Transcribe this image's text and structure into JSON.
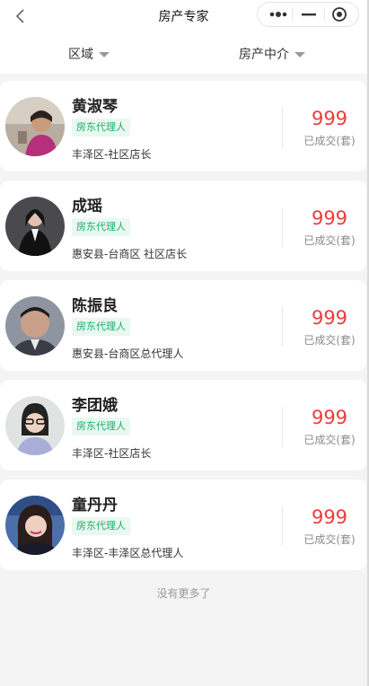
{
  "nav": {
    "title": "房产专家",
    "back_icon": "back-chevron-icon"
  },
  "capsule": {
    "more_icon": "more-dots-icon",
    "minimize_icon": "minus-icon",
    "close_icon": "target-circle-icon"
  },
  "filters": [
    {
      "label": "区域",
      "icon": "caret-down-icon"
    },
    {
      "label": "房产中介",
      "icon": "caret-down-icon"
    }
  ],
  "agents": [
    {
      "name": "黄淑琴",
      "tag": "房东代理人",
      "location": "丰泽区-社区店长",
      "deals": "999",
      "deals_label": "已成交(套)"
    },
    {
      "name": "成瑶",
      "tag": "房东代理人",
      "location": "惠安县-台商区 社区店长",
      "deals": "999",
      "deals_label": "已成交(套)"
    },
    {
      "name": "陈振良",
      "tag": "房东代理人",
      "location": "惠安县-台商区总代理人",
      "deals": "999",
      "deals_label": "已成交(套)"
    },
    {
      "name": "李团娥",
      "tag": "房东代理人",
      "location": "丰泽区-社区店长",
      "deals": "999",
      "deals_label": "已成交(套)"
    },
    {
      "name": "童丹丹",
      "tag": "房东代理人",
      "location": "丰泽区-丰泽区总代理人",
      "deals": "999",
      "deals_label": "已成交(套)"
    }
  ],
  "footer": {
    "no_more": "没有更多了"
  },
  "colors": {
    "accent_red": "#ee3b3b",
    "tag_green": "#1cae6b",
    "tag_bg": "#e9f8f0"
  }
}
